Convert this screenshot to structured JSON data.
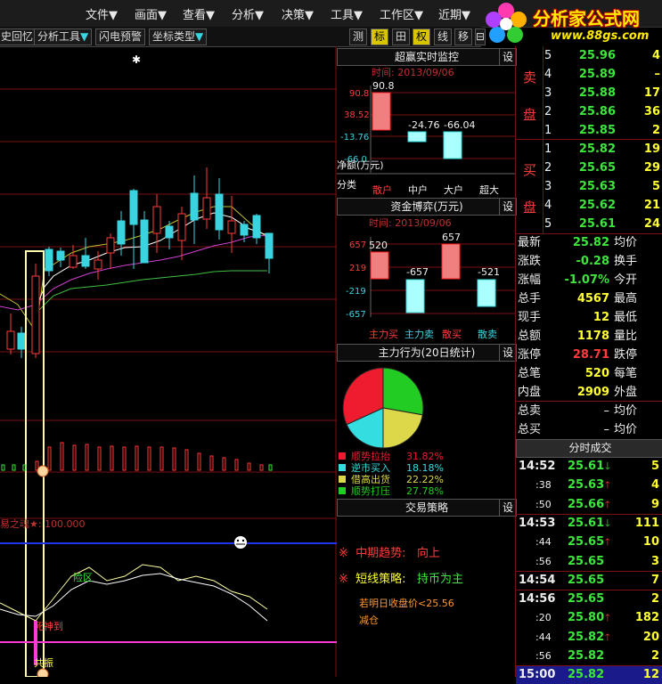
{
  "menu": [
    "文件▼",
    "画面▼",
    "查看▼",
    "分析▼",
    "决策▼",
    "工具▼",
    "工作区▼",
    "近期▼"
  ],
  "logo": {
    "title": "分析家公式网",
    "url": "www.88gs.com"
  },
  "toolbar": {
    "buttons": [
      "史回忆",
      "分析工具",
      "闪电预警",
      "坐标类型"
    ],
    "squares": [
      "测",
      "标",
      "田",
      "权",
      "线",
      "移",
      "⊟"
    ]
  },
  "chart": {
    "indicator1_label": "易之魂★: 100.000",
    "zone_label": "险区",
    "cross_label": "死神到",
    "resonance_label": "共振"
  },
  "monitor": {
    "title": "超赢实时监控",
    "set": "设",
    "time": "时间: 2013/09/06",
    "yticks": [
      "90.8",
      "38.52",
      "-13.76",
      "-66.0"
    ],
    "net_label": "净额(万元)",
    "class_label": "分类",
    "values": [
      "90.8",
      "-24.76",
      "-66.04"
    ],
    "categories": [
      "散户",
      "中户",
      "大户",
      "超大"
    ]
  },
  "fund": {
    "title": "资金博弈(万元)",
    "set": "设",
    "time": "时间: 2013/09/06",
    "yticks": [
      "657",
      "219",
      "-219",
      "-657"
    ],
    "values": [
      "520",
      "-657",
      "657",
      "-521"
    ],
    "categories": [
      "主力买",
      "主力卖",
      "散买",
      "散卖"
    ]
  },
  "behavior": {
    "title": "主力行为(20日统计)",
    "set": "设",
    "legend": [
      {
        "name": "顺势拉抬",
        "pct": "31.82%",
        "color": "#ee1c2e"
      },
      {
        "name": "逆市买入",
        "pct": "18.18%",
        "color": "#33dde0"
      },
      {
        "name": "借高出货",
        "pct": "22.22%",
        "color": "#dcd84a"
      },
      {
        "name": "顺势打压",
        "pct": "27.78%",
        "color": "#22cc22"
      }
    ]
  },
  "strategy": {
    "title": "交易策略",
    "set": "设",
    "trend_label": "中期趋势:",
    "trend_value": "向上",
    "short_label": "短线策略:",
    "short_value": "持币为主",
    "note1": "若明日收盘价<25.56",
    "note2": "减仓"
  },
  "orderbook": {
    "sell_label": [
      "卖",
      "盘"
    ],
    "buy_label": [
      "买",
      "盘"
    ],
    "sell": [
      {
        "lvl": "5",
        "price": "25.96",
        "vol": "4"
      },
      {
        "lvl": "4",
        "price": "25.89",
        "vol": "–"
      },
      {
        "lvl": "3",
        "price": "25.88",
        "vol": "17"
      },
      {
        "lvl": "2",
        "price": "25.86",
        "vol": "36"
      },
      {
        "lvl": "1",
        "price": "25.85",
        "vol": "2"
      }
    ],
    "buy": [
      {
        "lvl": "1",
        "price": "25.82",
        "vol": "19"
      },
      {
        "lvl": "2",
        "price": "25.65",
        "vol": "29"
      },
      {
        "lvl": "3",
        "price": "25.63",
        "vol": "5"
      },
      {
        "lvl": "4",
        "price": "25.62",
        "vol": "21"
      },
      {
        "lvl": "5",
        "price": "25.61",
        "vol": "24"
      }
    ]
  },
  "stats": [
    {
      "k": "最新",
      "v": "25.82",
      "k2": "均价"
    },
    {
      "k": "涨跌",
      "v": "-0.28",
      "k2": "换手"
    },
    {
      "k": "涨幅",
      "v": "-1.07%",
      "k2": "今开"
    },
    {
      "k": "总手",
      "v": "4567",
      "k2": "最高"
    },
    {
      "k": "现手",
      "v": "12",
      "k2": "最低"
    },
    {
      "k": "总额",
      "v": "1178",
      "k2": "量比"
    },
    {
      "k": "涨停",
      "v": "28.71",
      "k2": "跌停"
    },
    {
      "k": "总笔",
      "v": "520",
      "k2": "每笔"
    },
    {
      "k": "内盘",
      "v": "2909",
      "k2": "外盘"
    }
  ],
  "totals": [
    {
      "k": "总卖",
      "v": "–",
      "k2": "均价"
    },
    {
      "k": "总买",
      "v": "–",
      "k2": "均价"
    }
  ],
  "ticks_title": "分时成交",
  "ticks": [
    {
      "t": "14:52",
      "p": "25.61",
      "d": "down",
      "v": "5"
    },
    {
      "t": ":38",
      "p": "25.63",
      "d": "up",
      "v": "4"
    },
    {
      "t": ":50",
      "p": "25.66",
      "d": "up",
      "v": "9"
    },
    {
      "t": "14:53",
      "p": "25.61",
      "d": "down",
      "v": "111"
    },
    {
      "t": ":44",
      "p": "25.65",
      "d": "up",
      "v": "10"
    },
    {
      "t": ":56",
      "p": "25.65",
      "d": "",
      "v": "3"
    },
    {
      "t": "14:54",
      "p": "25.65",
      "d": "",
      "v": "7"
    },
    {
      "t": "14:56",
      "p": "25.65",
      "d": "",
      "v": "2"
    },
    {
      "t": ":20",
      "p": "25.80",
      "d": "up",
      "v": "182"
    },
    {
      "t": ":44",
      "p": "25.82",
      "d": "up",
      "v": "20"
    },
    {
      "t": ":56",
      "p": "25.82",
      "d": "",
      "v": "2"
    },
    {
      "t": "15:00",
      "p": "25.82",
      "d": "",
      "v": "12"
    }
  ]
}
